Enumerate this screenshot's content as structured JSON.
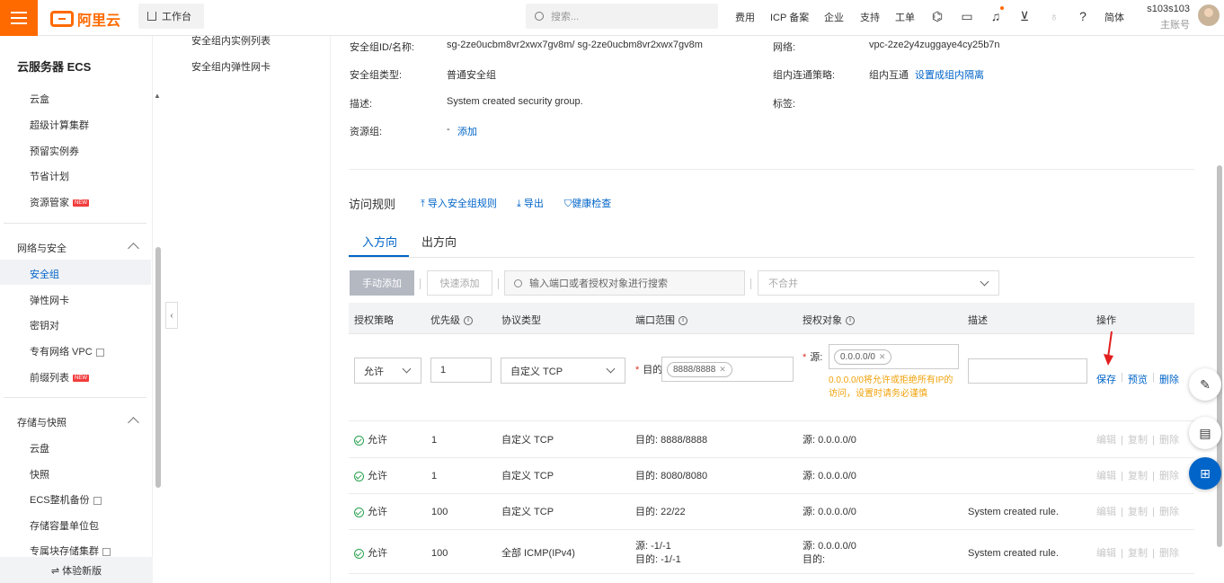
{
  "topbar": {
    "logo_text": "阿里云",
    "workbench": "工作台",
    "search_placeholder": "搜索...",
    "nav": [
      "费用",
      "ICP 备案",
      "企业",
      "支持",
      "工单"
    ],
    "lang": "简体",
    "username": "s103s103",
    "role": "主账号",
    "brand_color": "#ff6a00"
  },
  "sidebar": {
    "title": "云服务器 ECS",
    "group1": [
      "云盒",
      "超级计算集群",
      "预留实例券",
      "节省计划",
      "资源管家"
    ],
    "new_badge": "NEW",
    "section_network": "网络与安全",
    "network_items": [
      "安全组",
      "弹性网卡",
      "密钥对",
      "专有网络 VPC",
      "前缀列表"
    ],
    "section_storage": "存储与快照",
    "storage_items": [
      "云盘",
      "快照",
      "ECS整机备份",
      "存储容量单位包",
      "专属块存储集群"
    ],
    "experience": "⇌ 体验新版"
  },
  "subnav": {
    "items": [
      "安全组内实例列表",
      "安全组内弹性网卡"
    ]
  },
  "info": {
    "sg_id_label": "安全组ID/名称:",
    "sg_id_value": "sg-2ze0ucbm8vr2xwx7gv8m/ sg-2ze0ucbm8vr2xwx7gv8m",
    "type_label": "安全组类型:",
    "type_value": "普通安全组",
    "desc_label": "描述:",
    "desc_value": "System created security group.",
    "rg_label": "资源组:",
    "rg_dash": "-",
    "rg_add": "添加",
    "network_label": "网络:",
    "network_value": "vpc-2ze2y4zuggaye4cy25b7n",
    "policy_label": "组内连通策略:",
    "policy_value": "组内互通",
    "policy_link": "设置成组内隔离",
    "tag_label": "标签:"
  },
  "rules": {
    "title": "访问规则",
    "import": "导入安全组规则",
    "export": "导出",
    "health": "健康检查",
    "tab_in": "入方向",
    "tab_out": "出方向",
    "btn_manual": "手动添加",
    "btn_quick": "快速添加",
    "search_placeholder": "输入端口或者授权对象进行搜索",
    "merge": "不合并",
    "headers": [
      "授权策略",
      "优先级",
      "协议类型",
      "端口范围",
      "授权对象",
      "描述",
      "操作"
    ]
  },
  "edit_row": {
    "policy": "允许",
    "priority": "1",
    "protocol": "自定义 TCP",
    "dest_label": "目的:",
    "port_tag": "8888/8888",
    "src_label": "源:",
    "src_tag": "0.0.0.0/0",
    "warning": "0.0.0.0/0将允许或拒绝所有IP的访问，设置时请务必谨慎",
    "save": "保存",
    "preview": "预览",
    "delete": "删除"
  },
  "rows": [
    {
      "policy": "允许",
      "priority": "1",
      "protocol": "自定义 TCP",
      "port": "目的: 8888/8888",
      "port2": "",
      "source": "源: 0.0.0.0/0",
      "source2": "",
      "desc": ""
    },
    {
      "policy": "允许",
      "priority": "1",
      "protocol": "自定义 TCP",
      "port": "目的: 8080/8080",
      "port2": "",
      "source": "源: 0.0.0.0/0",
      "source2": "",
      "desc": ""
    },
    {
      "policy": "允许",
      "priority": "100",
      "protocol": "自定义 TCP",
      "port": "目的: 22/22",
      "port2": "",
      "source": "源: 0.0.0.0/0",
      "source2": "",
      "desc": "System created rule."
    },
    {
      "policy": "允许",
      "priority": "100",
      "protocol": "全部 ICMP(IPv4)",
      "port": "源: -1/-1",
      "port2": "目的: -1/-1",
      "source": "源: 0.0.0.0/0",
      "source2": "目的:",
      "desc": "System created rule."
    }
  ],
  "row_ops": {
    "edit": "编辑",
    "copy": "复制",
    "delete": "删除"
  }
}
